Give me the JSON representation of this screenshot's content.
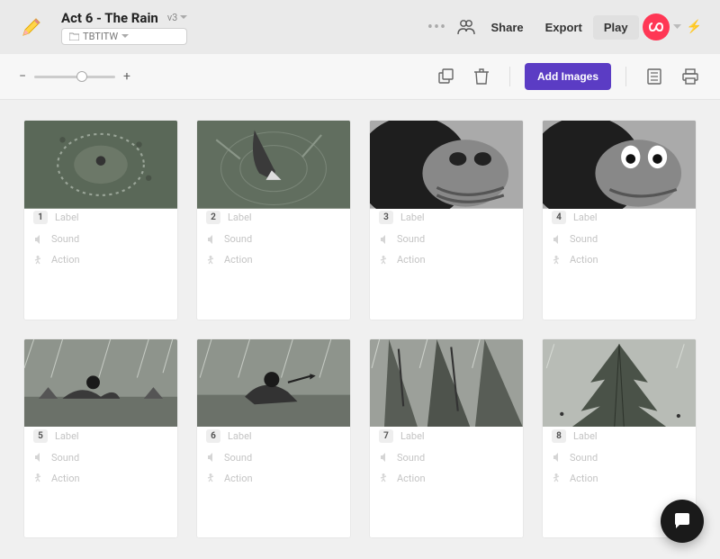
{
  "header": {
    "title": "Act 6 - The Rain",
    "version": "v3",
    "folder": "TBTITW",
    "share": "Share",
    "export": "Export",
    "play": "Play"
  },
  "toolbar": {
    "add_images": "Add Images"
  },
  "placeholders": {
    "label": "Label",
    "sound": "Sound",
    "action": "Action"
  },
  "frames": [
    {
      "num": "1"
    },
    {
      "num": "2"
    },
    {
      "num": "3"
    },
    {
      "num": "4"
    },
    {
      "num": "5"
    },
    {
      "num": "6"
    },
    {
      "num": "7"
    },
    {
      "num": "8"
    }
  ]
}
